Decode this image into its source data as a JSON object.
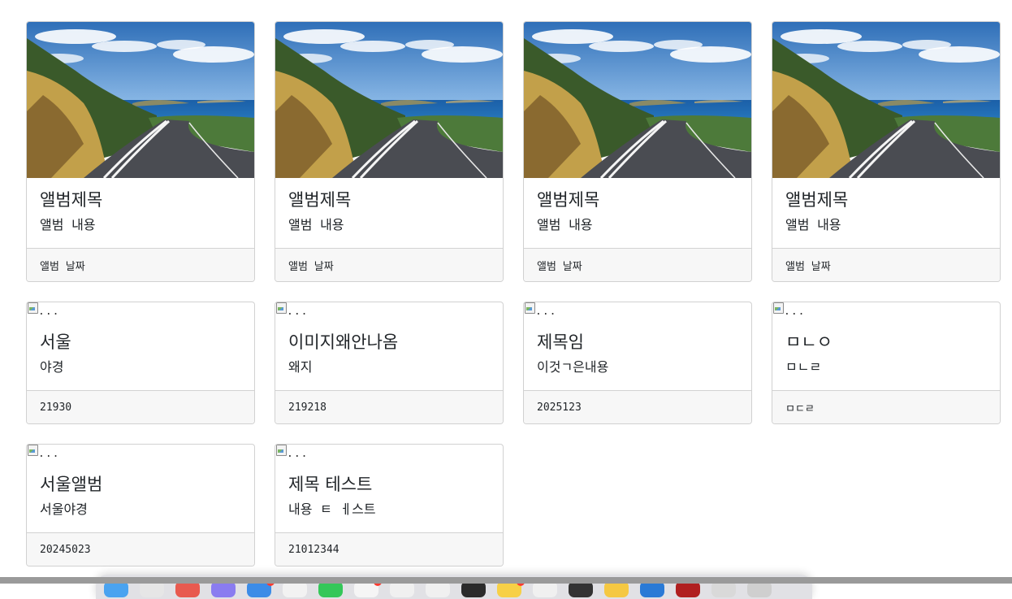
{
  "cards": [
    {
      "image": "photo",
      "title": "앨범제목",
      "text": "앨범 내용",
      "footer": "앨범 날짜"
    },
    {
      "image": "photo",
      "title": "앨범제목",
      "text": "앨범 내용",
      "footer": "앨범 날짜"
    },
    {
      "image": "photo",
      "title": "앨범제목",
      "text": "앨범 내용",
      "footer": "앨범 날짜"
    },
    {
      "image": "photo",
      "title": "앨범제목",
      "text": "앨범 내용",
      "footer": "앨범 날짜"
    },
    {
      "image": "broken",
      "alt": "...",
      "title": "서울",
      "text": "야경",
      "footer": "21930"
    },
    {
      "image": "broken",
      "alt": "...",
      "title": "이미지왜안나옴",
      "text": "왜지",
      "footer": "219218"
    },
    {
      "image": "broken",
      "alt": "...",
      "title": "제목임",
      "text": "이것ㄱ은내용",
      "footer": "2025123"
    },
    {
      "image": "broken",
      "alt": "...",
      "title": "ㅁㄴㅇ",
      "text": "ㅁㄴㄹ",
      "footer": "ㅁㄷㄹ"
    },
    {
      "image": "broken",
      "alt": "...",
      "title": "서울앨범",
      "text": "서울야경",
      "footer": "20245023"
    },
    {
      "image": "broken",
      "alt": "...",
      "title": "제목 테스트",
      "text": "내용 ㅌ ㅔ스트",
      "footer": "21012344"
    }
  ],
  "dock": {
    "apps": [
      {
        "icon": "finder-icon",
        "color": "#4aa3f0"
      },
      {
        "icon": "launchpad-icon",
        "color": "#e6e6e6"
      },
      {
        "icon": "app-icon",
        "color": "#e85a4f"
      },
      {
        "icon": "app-icon",
        "color": "#8a7cf0"
      },
      {
        "icon": "mail-icon",
        "color": "#3c8ce7"
      },
      {
        "icon": "app-icon",
        "color": "#f2f2f2"
      },
      {
        "icon": "messages-icon",
        "color": "#34c759"
      },
      {
        "icon": "calendar-icon",
        "color": "#f5f5f5"
      },
      {
        "icon": "app-icon",
        "color": "#f0f0f0"
      },
      {
        "icon": "app-icon",
        "color": "#f0f0f0"
      },
      {
        "icon": "terminal-icon",
        "color": "#2b2b2b"
      },
      {
        "icon": "notes-icon",
        "color": "#f7d046"
      },
      {
        "icon": "app-icon",
        "color": "#f0f0f0"
      },
      {
        "icon": "app-icon",
        "color": "#333333"
      },
      {
        "icon": "app-icon",
        "color": "#f5c842"
      },
      {
        "icon": "vscode-icon",
        "color": "#2a7ad6"
      },
      {
        "icon": "app-icon",
        "color": "#b02020"
      },
      {
        "icon": "app-icon",
        "color": "#d9d9d9"
      },
      {
        "icon": "trash-icon",
        "color": "#cfcfcf"
      }
    ]
  }
}
